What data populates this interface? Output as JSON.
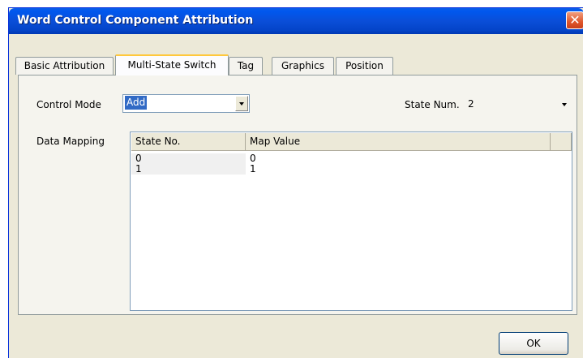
{
  "window": {
    "title": "Word Control Component Attribution"
  },
  "tabs": [
    {
      "label": "Basic Attribution"
    },
    {
      "label": "Multi-State Switch"
    },
    {
      "label": "Tag"
    },
    {
      "label": "Graphics"
    },
    {
      "label": "Position"
    }
  ],
  "active_tab": "Multi-State Switch",
  "control_mode": {
    "label": "Control Mode",
    "value": "Add"
  },
  "state_num": {
    "label": "State Num.",
    "value": "2"
  },
  "data_mapping": {
    "label": "Data Mapping",
    "columns": [
      "State No.",
      "Map Value"
    ],
    "rows": [
      {
        "state_no": "0",
        "map_value": "0"
      },
      {
        "state_no": "1",
        "map_value": "1"
      }
    ]
  },
  "buttons": {
    "ok": "OK"
  },
  "colors": {
    "title_bar": "#0a4ed8",
    "dialog_bg": "#ece9d8",
    "selection": "#316ac5",
    "close": "#e0562b"
  },
  "icons": [
    "close-icon",
    "chevron-down-icon"
  ]
}
